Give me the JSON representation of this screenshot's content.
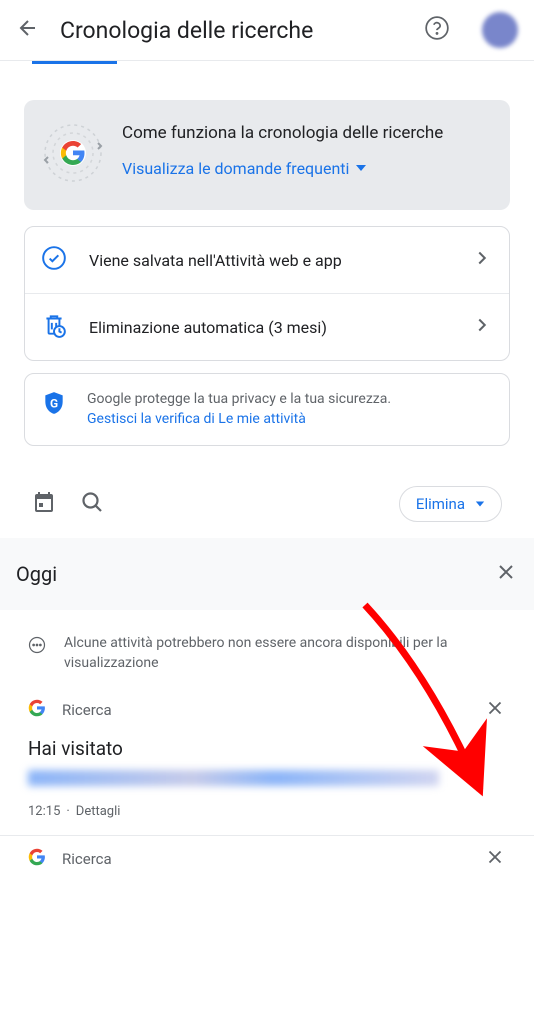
{
  "header": {
    "title": "Cronologia delle ricerche"
  },
  "info_card": {
    "title": "Come funziona la cronologia delle ricerche",
    "link": "Visualizza le domande frequenti"
  },
  "settings": {
    "saved_label": "Viene salvata nell'Attività web e app",
    "auto_delete_label": "Eliminazione automatica (3 mesi)"
  },
  "privacy": {
    "text": "Google protegge la tua privacy e la tua sicurezza.",
    "link": "Gestisci la verifica di Le mie attività"
  },
  "toolbar": {
    "delete": "Elimina"
  },
  "section": {
    "today": "Oggi"
  },
  "notice": {
    "text": "Alcune attività potrebbero non essere ancora disponibili per la visualizzazione"
  },
  "activity": {
    "app": "Ricerca",
    "visited": "Hai visitato",
    "time": "12:15",
    "details": "Dettagli",
    "app2": "Ricerca"
  }
}
